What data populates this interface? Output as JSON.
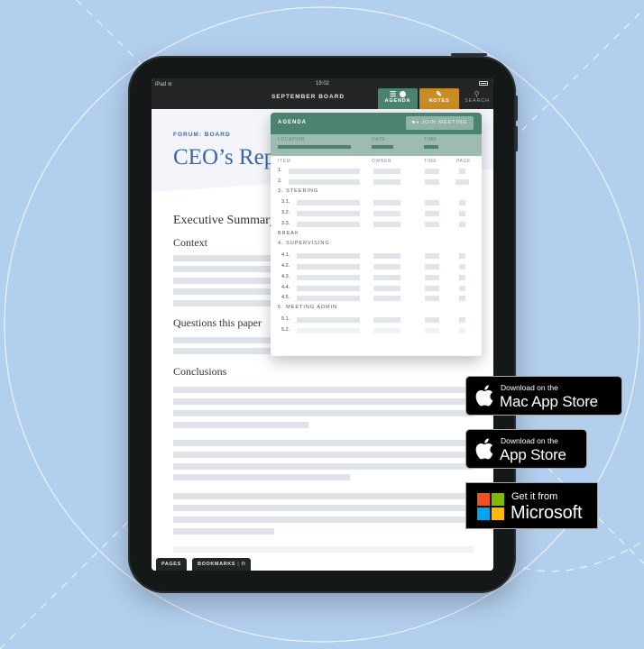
{
  "device": {
    "status_bar": {
      "device_label": "iPad",
      "time": "19:02"
    },
    "nav": {
      "title": "SEPTEMBER BOARD",
      "tabs": [
        {
          "label": "AGENDA",
          "icon": "list-icon",
          "active": true,
          "color": "#4b8370"
        },
        {
          "label": "NOTES",
          "icon": "edit-icon",
          "color": "#c98b23"
        },
        {
          "label": "SEARCH",
          "icon": "search-icon"
        }
      ]
    }
  },
  "document": {
    "forum": "FORUM: BOARD",
    "title": "CEO’s Report",
    "sections": {
      "executive_summary": "Executive Summary",
      "context": "Context",
      "questions": "Questions this paper",
      "conclusions": "Conclusions"
    },
    "bottom_tabs": {
      "pages": "PAGES",
      "bookmarks": "BOOKMARKS"
    }
  },
  "agenda_popover": {
    "title": "AGENDA",
    "join_button": "JOIN MEETING",
    "meta_labels": {
      "location": "LOCATION",
      "date": "DATE",
      "time": "TIME"
    },
    "columns": {
      "item": "ITEM",
      "owner": "OWNER",
      "time": "TIME",
      "page": "PAGE"
    },
    "rows": [
      {
        "type": "item",
        "num": "1."
      },
      {
        "type": "item",
        "num": "2."
      },
      {
        "type": "section",
        "label": "3. STEERING"
      },
      {
        "type": "sub",
        "num": "3.1."
      },
      {
        "type": "sub",
        "num": "3.2."
      },
      {
        "type": "sub",
        "num": "3.3."
      },
      {
        "type": "section",
        "label": "BREAK"
      },
      {
        "type": "section",
        "label": "4. SUPERVISING"
      },
      {
        "type": "sub",
        "num": "4.1."
      },
      {
        "type": "sub",
        "num": "4.2."
      },
      {
        "type": "sub",
        "num": "4.3."
      },
      {
        "type": "sub",
        "num": "4.4."
      },
      {
        "type": "sub",
        "num": "4.5."
      },
      {
        "type": "section",
        "label": "5. MEETING ADMIN"
      },
      {
        "type": "sub",
        "num": "5.1."
      },
      {
        "type": "sub",
        "num": "5.2.",
        "faded": true
      }
    ]
  },
  "store_badges": {
    "mac": {
      "small": "Download on the",
      "big": "Mac App Store"
    },
    "ios": {
      "small": "Download on the",
      "big": "App Store"
    },
    "microsoft": {
      "small": "Get it from",
      "big": "Microsoft",
      "colors": [
        "#f25022",
        "#7fba00",
        "#00a4ef",
        "#ffb900"
      ]
    }
  }
}
